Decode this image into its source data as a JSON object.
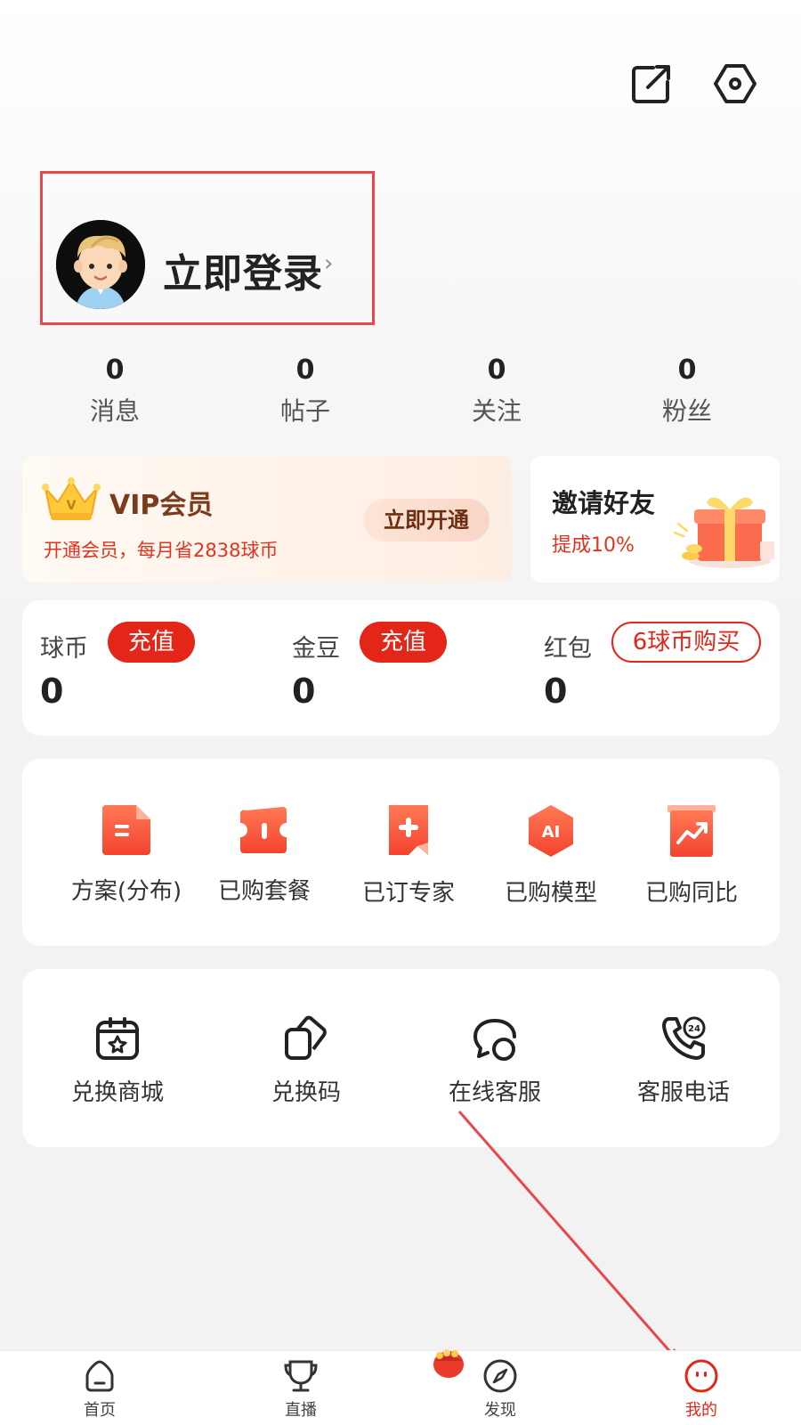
{
  "header": {
    "share_icon": "share-icon",
    "settings_icon": "settings-icon"
  },
  "profile": {
    "login_label": "立即登录",
    "chevron": "›"
  },
  "stats": [
    {
      "value": "0",
      "label": "消息"
    },
    {
      "value": "0",
      "label": "帖子"
    },
    {
      "value": "0",
      "label": "关注"
    },
    {
      "value": "0",
      "label": "粉丝"
    }
  ],
  "vip": {
    "title": "VIP会员",
    "subtitle": "开通会员，每月省2838球币",
    "button": "立即开通"
  },
  "invite": {
    "title": "邀请好友",
    "subtitle": "提成10%"
  },
  "wallet": [
    {
      "label": "球币",
      "button": "充值",
      "value": "0"
    },
    {
      "label": "金豆",
      "button": "充值",
      "value": "0"
    },
    {
      "label": "红包",
      "button": "6球币购买",
      "value": "0"
    }
  ],
  "orders": [
    {
      "label": "方案(分布)",
      "icon": "document-icon"
    },
    {
      "label": "已购套餐",
      "icon": "ticket-icon"
    },
    {
      "label": "已订专家",
      "icon": "bookmark-plus-icon"
    },
    {
      "label": "已购模型",
      "icon": "ai-hexagon-icon"
    },
    {
      "label": "已购同比",
      "icon": "trend-chart-icon"
    }
  ],
  "services": [
    {
      "label": "兑换商城",
      "icon": "star-bag-icon"
    },
    {
      "label": "兑换码",
      "icon": "copy-icon"
    },
    {
      "label": "在线客服",
      "icon": "chat-icon"
    },
    {
      "label": "客服电话",
      "icon": "phone-24-icon"
    }
  ],
  "tabbar": [
    {
      "label": "首页",
      "icon": "home-icon"
    },
    {
      "label": "直播",
      "icon": "trophy-icon"
    },
    {
      "label": "发现",
      "icon": "compass-icon"
    },
    {
      "label": "我的",
      "icon": "face-icon",
      "active": true
    }
  ],
  "colors": {
    "accent": "#e42618",
    "annotation": "#e8474b",
    "vip_text": "#7a3b1c"
  }
}
